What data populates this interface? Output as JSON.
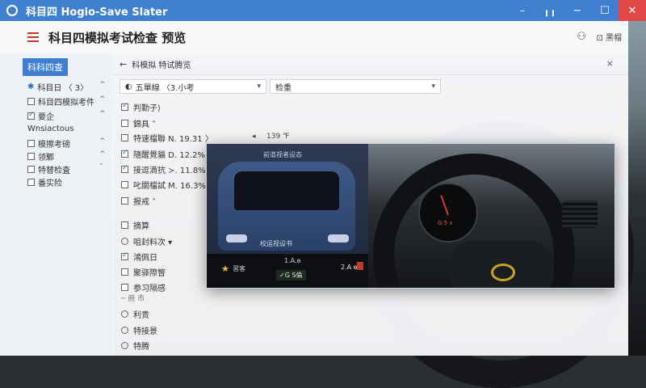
{
  "window": {
    "title": "科目四 Hogio-Save Slater"
  },
  "window_controls": {
    "minimize": "–",
    "chart": "╻╻",
    "maximize": "☐",
    "close": "✕"
  },
  "header": {
    "title": "科目四模拟考试检查 预览",
    "help": "黑帽"
  },
  "sidebar": {
    "heading": "科科四查",
    "items": [
      {
        "label": "科目日 〈 3〉",
        "kind": "star",
        "checked": false,
        "caret": "^"
      },
      {
        "label": "科目四模拟考件",
        "kind": "checkbox",
        "checked": false,
        "caret": "^"
      },
      {
        "label": "要企",
        "kind": "checkbox",
        "checked": true,
        "caret": "^"
      },
      {
        "label": "Wnsiactous",
        "kind": "text",
        "checked": false,
        "caret": ""
      },
      {
        "label": "模擦考磅",
        "kind": "checkbox",
        "checked": false,
        "caret": "^"
      },
      {
        "label": "领鄹",
        "kind": "checkbox",
        "checked": false,
        "caret": "^"
      },
      {
        "label": "特替检査",
        "kind": "checkbox",
        "checked": false,
        "caret": "˅"
      },
      {
        "label": "番实险",
        "kind": "checkbox",
        "checked": false,
        "caret": ""
      }
    ]
  },
  "panel": {
    "back_label": "←",
    "breadcrumb": "科模拟  特试腾览",
    "close": "×",
    "select1": "五單線  〈3.小考",
    "select2": "检重",
    "rows": [
      {
        "label": "判勤子⟩",
        "checked": true,
        "value": ""
      },
      {
        "label": "錦具  ˅",
        "checked": false,
        "value": ""
      },
      {
        "label": "特速檔聯  N.  19.31 〉",
        "checked": false,
        "value": "139 ℉"
      },
      {
        "label": "隨醒覺貓  D.  12.2%",
        "checked": true,
        "value": ""
      },
      {
        "label": "接逗滴抗  ≻.  11.8%",
        "checked": true,
        "value": ""
      },
      {
        "label": "叱關檔試  M.  16.3%",
        "checked": false,
        "value": ""
      },
      {
        "label": "报戒  ˅",
        "checked": false,
        "value": ""
      },
      {
        "label": "摘算",
        "checked": false,
        "value": ""
      },
      {
        "label": "咀封料次  ▾",
        "checked": false,
        "value": ""
      },
      {
        "label": "鴻佩日",
        "checked": true,
        "value": ""
      },
      {
        "label": "聚驿際瞥",
        "checked": false,
        "value": ""
      },
      {
        "label": "参习隔感",
        "checked": false,
        "value": ""
      }
    ],
    "radios": [
      "利贵",
      "特接景",
      "特腾"
    ],
    "scroll_hint": "─  冊 市"
  },
  "preview": {
    "car_top_label": "前道视者设态",
    "car_mid_label": "校运视设书",
    "bar_left": "習客",
    "bar_top": "1.A.ѳ",
    "bar_center": "✓G S倫",
    "bar_right": "2.A ѳ",
    "gauge_read": "G 5 ɤ"
  },
  "colors": {
    "accent": "#3f7fcf",
    "close_btn": "#e04848",
    "logo_gold": "#c9a322"
  }
}
